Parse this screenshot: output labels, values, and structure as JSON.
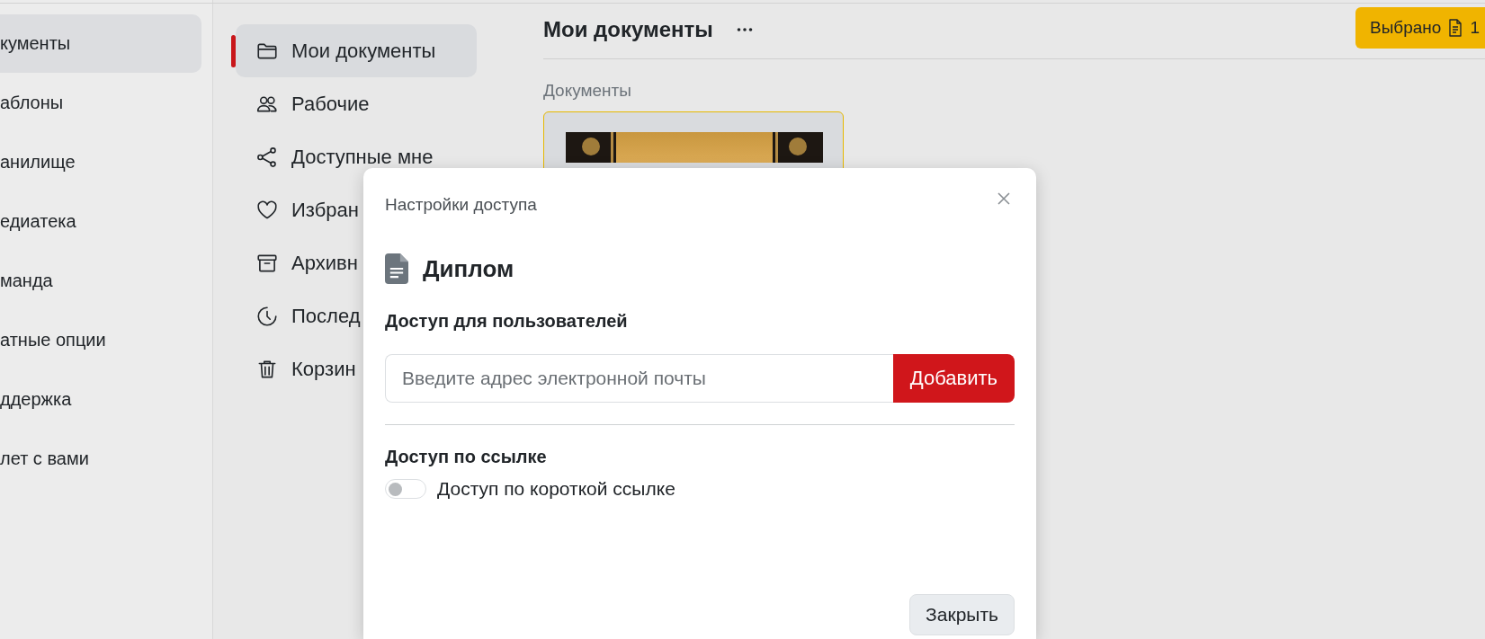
{
  "left_nav": {
    "items": [
      {
        "label": "кументы",
        "selected": true
      },
      {
        "label": "аблоны",
        "selected": false
      },
      {
        "label": "анилище",
        "selected": false
      },
      {
        "label": "едиатека",
        "selected": false
      },
      {
        "label": "манда",
        "selected": false
      },
      {
        "label": "атные опции",
        "selected": false
      },
      {
        "label": "ддержка",
        "selected": false
      },
      {
        "label": "лет с вами",
        "selected": false
      }
    ]
  },
  "nav": {
    "items": [
      {
        "label": "Мои документы",
        "selected": true
      },
      {
        "label": "Рабочие",
        "selected": false
      },
      {
        "label": "Доступные мне",
        "selected": false
      },
      {
        "label": "Избран",
        "selected": false
      },
      {
        "label": "Архивн",
        "selected": false
      },
      {
        "label": "Послед",
        "selected": false
      },
      {
        "label": "Корзин",
        "selected": false
      }
    ]
  },
  "header": {
    "title": "Мои документы",
    "selected_button": {
      "label": "Выбрано",
      "count": "1"
    }
  },
  "section_title": "Документы",
  "documents": [
    {
      "kind": "picture",
      "selected": true
    }
  ],
  "modal": {
    "title": "Настройки доступа",
    "document": "Диплом",
    "users_heading": "Доступ для пользователей",
    "email": {
      "placeholder": "Введите адрес электронной почты"
    },
    "add_button": "Добавить",
    "link_heading": "Доступ по ссылке",
    "short_link": {
      "label": "Доступ по короткой ссылке",
      "on": false
    },
    "close_button": "Закрыть"
  }
}
